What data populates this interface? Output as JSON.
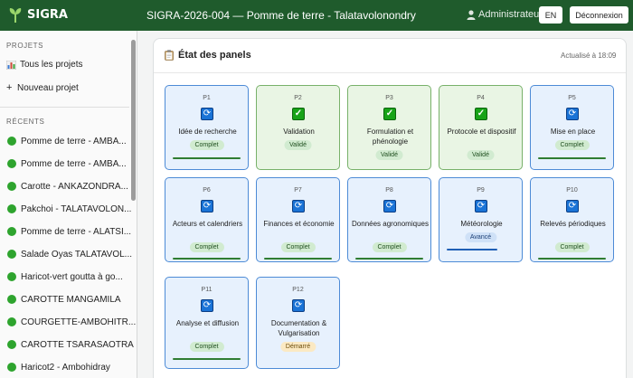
{
  "app": {
    "name": "SIGRA",
    "project_title": "SIGRA-2026-004 — Pomme de terre - Talatavolonondry",
    "user": "Administrateur",
    "lang": "EN",
    "logout": "Déconnexion"
  },
  "sidebar": {
    "projects_heading": "PROJETS",
    "all_projects": "Tous les projets",
    "new_project": "Nouveau projet",
    "recent_heading": "RÉCENTS",
    "recent": [
      "Pomme de terre - AMBA...",
      "Pomme de terre - AMBA...",
      "Carotte - ANKAZONDRA...",
      "Pakchoi - TALATAVOLON...",
      "Pomme de terre - ALATSI...",
      "Salade Oyas TALATAVOL...",
      "Haricot-vert goutta à go...",
      "CAROTTE MANGAMILA",
      "COURGETTE-AMBOHITR...",
      "CAROTTE TSARASAOTRA",
      "Haricot2 - Ambohidray"
    ]
  },
  "panels_card": {
    "title": "État des panels",
    "updated": "Actualisé à 18:09"
  },
  "panels": [
    {
      "id": "P1",
      "name": "Idée de recherche",
      "status": "Complet",
      "icon": "refresh-icon",
      "progress": 1.0
    },
    {
      "id": "P2",
      "name": "Validation",
      "status": "Validé",
      "icon": "check-icon",
      "progress": null
    },
    {
      "id": "P3",
      "name": "Formulation et phénologie",
      "status": "Validé",
      "icon": "check-icon",
      "progress": null
    },
    {
      "id": "P4",
      "name": "Protocole et dispositif",
      "status": "Validé",
      "icon": "check-icon",
      "progress": null
    },
    {
      "id": "P5",
      "name": "Mise en place",
      "status": "Complet",
      "icon": "refresh-icon",
      "progress": 1.0
    },
    {
      "id": "P6",
      "name": "Acteurs et calendriers",
      "status": "Complet",
      "icon": "refresh-icon",
      "progress": 1.0
    },
    {
      "id": "P7",
      "name": "Finances et économie",
      "status": "Complet",
      "icon": "refresh-icon",
      "progress": 1.0
    },
    {
      "id": "P8",
      "name": "Données agronomiques",
      "status": "Complet",
      "icon": "refresh-icon",
      "progress": 1.0
    },
    {
      "id": "P9",
      "name": "Météorologie",
      "status": "Avancé",
      "icon": "refresh-icon",
      "progress": 0.75
    },
    {
      "id": "P10",
      "name": "Relevés périodiques",
      "status": "Complet",
      "icon": "refresh-icon",
      "progress": 1.0
    },
    {
      "id": "P11",
      "name": "Analyse et diffusion",
      "status": "Complet",
      "icon": "refresh-icon",
      "progress": 1.0
    },
    {
      "id": "P12",
      "name": "Documentation & Vulgarisation",
      "status": "Démarré",
      "icon": "refresh-icon",
      "progress": null
    }
  ],
  "colors": {
    "brand": "#1f5b2c",
    "complete": "#2f7d32",
    "advanced": "#1f5fb5",
    "recent_dot": "#2ea42e"
  }
}
